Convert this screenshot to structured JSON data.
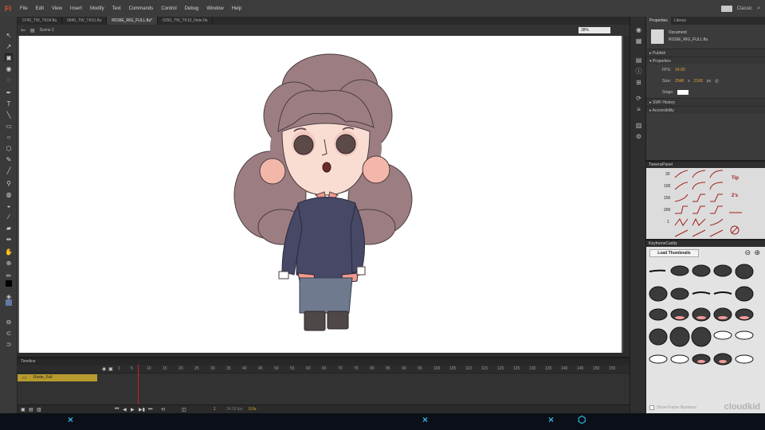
{
  "app": {
    "logo": "Fl",
    "workspace": "Classic"
  },
  "menu": [
    "File",
    "Edit",
    "View",
    "Insert",
    "Modify",
    "Text",
    "Commands",
    "Control",
    "Debug",
    "Window",
    "Help"
  ],
  "doc_tabs": [
    "0740_TW_TK04.fla",
    "0840_TW_TK01.fla",
    "ROSIE_RIG_FULL.fla*",
    "0250_TW_TK10_Note.fla"
  ],
  "active_tab": 2,
  "editbar": {
    "scene": "Scene 1",
    "zoom": "38%"
  },
  "timeline": {
    "title": "Timeline",
    "ruler": [
      "1",
      "5",
      "10",
      "15",
      "20",
      "25",
      "30",
      "35",
      "40",
      "45",
      "50",
      "55",
      "60",
      "65",
      "70",
      "75",
      "80",
      "85",
      "90",
      "95",
      "100",
      "105",
      "110",
      "115",
      "120",
      "125",
      "130",
      "135",
      "140",
      "145",
      "150",
      "155"
    ],
    "layer": "Rosie_Full",
    "fps": "24.00 fps",
    "time": "0.0s",
    "frame": "1"
  },
  "properties": {
    "tabs": [
      "Properties",
      "Library"
    ],
    "doc_label": "Document",
    "filename": "ROSIE_RIG_FULL.fla",
    "sections": {
      "publish": "Publish",
      "properties": "Properties",
      "swf_history": "SWF History",
      "accessibility": "Accessibility"
    },
    "fps_label": "FPS:",
    "fps_value": "24.00",
    "size_label": "Size:",
    "width": "2048",
    "x": "x",
    "height": "2168",
    "unit": "px",
    "stage_label": "Stage:"
  },
  "tweens_panel": {
    "title": "TweensPanel",
    "values": [
      "30",
      "100",
      "150",
      "200",
      "1"
    ],
    "labels": [
      "Tip",
      "2's"
    ]
  },
  "keyframe_caddy": {
    "title": "KeyframeCaddy",
    "load_button": "Load Thumbnails",
    "show_frame_numbers": "Show Frame Numbers",
    "brand": "cloudkid"
  },
  "colors": {
    "accent": "#e0522a",
    "layer": "#b79a2d",
    "frame_value": "#e4a13a"
  }
}
